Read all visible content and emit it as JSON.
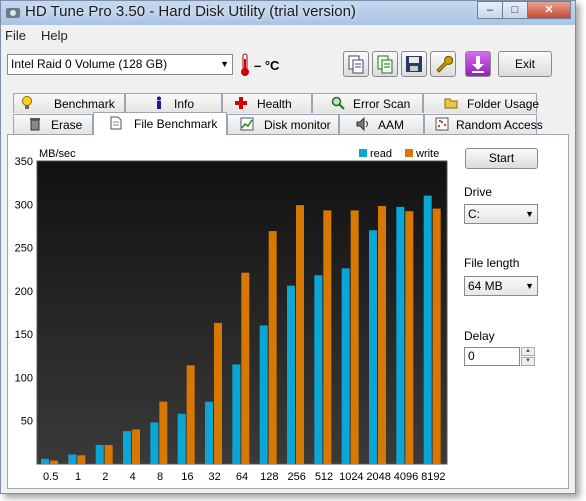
{
  "window": {
    "title": "HD Tune Pro 3.50 - Hard Disk Utility (trial version)"
  },
  "menu": {
    "file": "File",
    "help": "Help"
  },
  "toolbar": {
    "drive": "Intel    Raid 0 Volume (128 GB)",
    "temperature": "– °C",
    "exit": "Exit"
  },
  "tabs_row1": [
    "Benchmark",
    "Info",
    "Health",
    "Error Scan",
    "Folder Usage"
  ],
  "tabs_row2": [
    "Erase",
    "File Benchmark",
    "Disk monitor",
    "AAM",
    "Random Access"
  ],
  "active_tab": "File Benchmark",
  "side": {
    "start": "Start",
    "drive_label": "Drive",
    "drive_value": "C:",
    "file_length_label": "File length",
    "file_length_value": "64 MB",
    "delay_label": "Delay",
    "delay_value": "0"
  },
  "colors": {
    "read": "#0aa6d6",
    "write": "#d97800",
    "plot_bg": "#1a1a1a"
  },
  "chart_data": {
    "type": "bar",
    "ylabel": "MB/sec",
    "ylim": [
      0,
      350
    ],
    "yticks": [
      50,
      100,
      150,
      200,
      250,
      300,
      350
    ],
    "categories": [
      "0.5",
      "1",
      "2",
      "4",
      "8",
      "16",
      "32",
      "64",
      "128",
      "256",
      "512",
      "1024",
      "2048",
      "4096",
      "8192"
    ],
    "series": [
      {
        "name": "read",
        "values": [
          6,
          11,
          22,
          38,
          48,
          58,
          72,
          115,
          160,
          206,
          218,
          226,
          270,
          297,
          310
        ]
      },
      {
        "name": "write",
        "values": [
          4,
          10,
          22,
          40,
          72,
          114,
          163,
          221,
          269,
          299,
          293,
          293,
          298,
          292,
          295
        ]
      }
    ],
    "legend_position": "top-right",
    "grid": false
  }
}
